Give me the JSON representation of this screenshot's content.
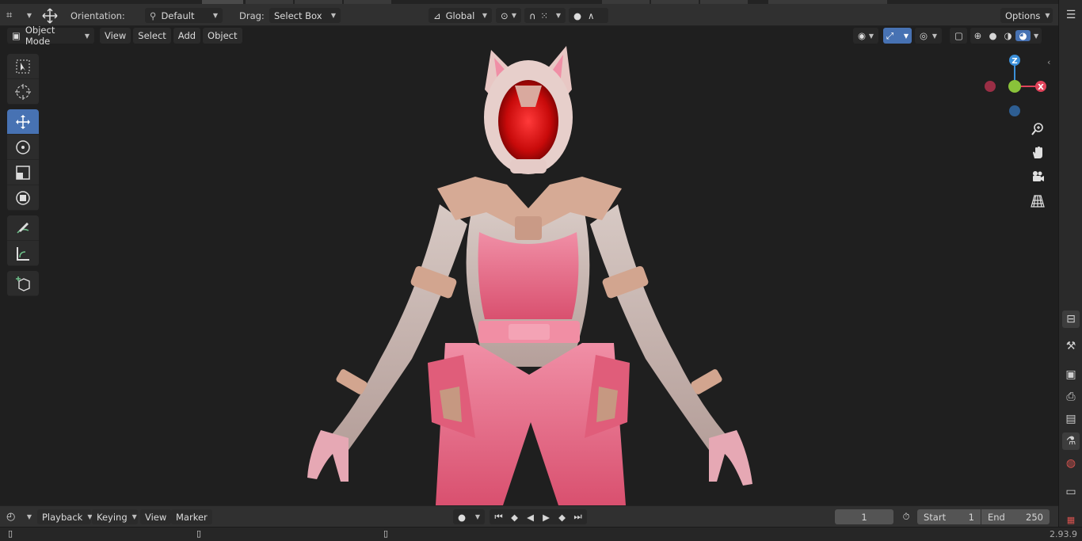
{
  "header": {
    "orientation_label": "Orientation:",
    "orientation_value": "Default",
    "drag_label": "Drag:",
    "drag_value": "Select Box",
    "transform_value": "Global",
    "options_label": "Options"
  },
  "viewport_header": {
    "mode": "Object Mode",
    "menus": [
      "View",
      "Select",
      "Add",
      "Object"
    ]
  },
  "toolbar": {
    "tools": [
      "select-box",
      "cursor",
      "move",
      "rotate",
      "scale",
      "transform",
      "annotate",
      "measure",
      "add-cube"
    ],
    "active_tool": "move"
  },
  "gizmo": {
    "z_label": "Z",
    "x_label": "X",
    "colors": {
      "x": "#e0435a",
      "y": "#8ac23a",
      "z": "#3b8fd9"
    }
  },
  "timeline": {
    "menus": [
      "Playback",
      "Keying",
      "View",
      "Marker"
    ],
    "current_frame": "1",
    "start_label": "Start",
    "start_value": "1",
    "end_label": "End",
    "end_value": "250"
  },
  "status": {
    "version": "2.93.9"
  },
  "colors": {
    "accent": "#4772b3",
    "header_bg": "#303030",
    "viewport_bg": "#1f1f1f"
  }
}
